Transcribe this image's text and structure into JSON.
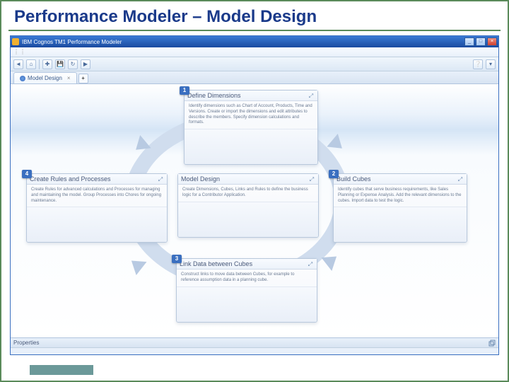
{
  "slide": {
    "title": "Performance Modeler – Model Design"
  },
  "window": {
    "title": "IBM Cognos TM1 Performance Modeler",
    "min": "_",
    "max": "□",
    "close": "×"
  },
  "toolbar": {
    "back": "◄",
    "home": "⌂",
    "new": "✚",
    "save": "💾",
    "refresh": "↻",
    "run": "▶",
    "help": "❔",
    "help_dd": "▾"
  },
  "tab": {
    "label": "Model Design",
    "close": "×",
    "plus": "+"
  },
  "cards": {
    "c1": {
      "num": "1",
      "title": "Define Dimensions",
      "body": "Identify dimensions such as Chart of Account, Products, Time and Versions. Create or import the dimensions and edit attributes to describe the members. Specify dimension calculations and formats."
    },
    "c2": {
      "num": "2",
      "title": "Build Cubes",
      "body": "Identify cubes that serve business requirements, like Sales Planning or Expense Analysis. Add the relevant dimensions to the cubes. Import data to test the logic."
    },
    "c3": {
      "num": "3",
      "title": "Link Data between Cubes",
      "body": "Construct links to move data between Cubes, for example to reference assumption data in a planning cube."
    },
    "c4": {
      "num": "4",
      "title": "Create Rules and Processes",
      "body": "Create Rules for advanced calculations and Processes for managing and maintaining the model. Group Processes into Chores for ongoing maintenance."
    },
    "c5": {
      "num": "",
      "title": "Model Design",
      "body": "Create Dimensions, Cubes, Links and Rules to define the business logic for a Contributor Application."
    }
  },
  "props": {
    "label": "Properties"
  }
}
